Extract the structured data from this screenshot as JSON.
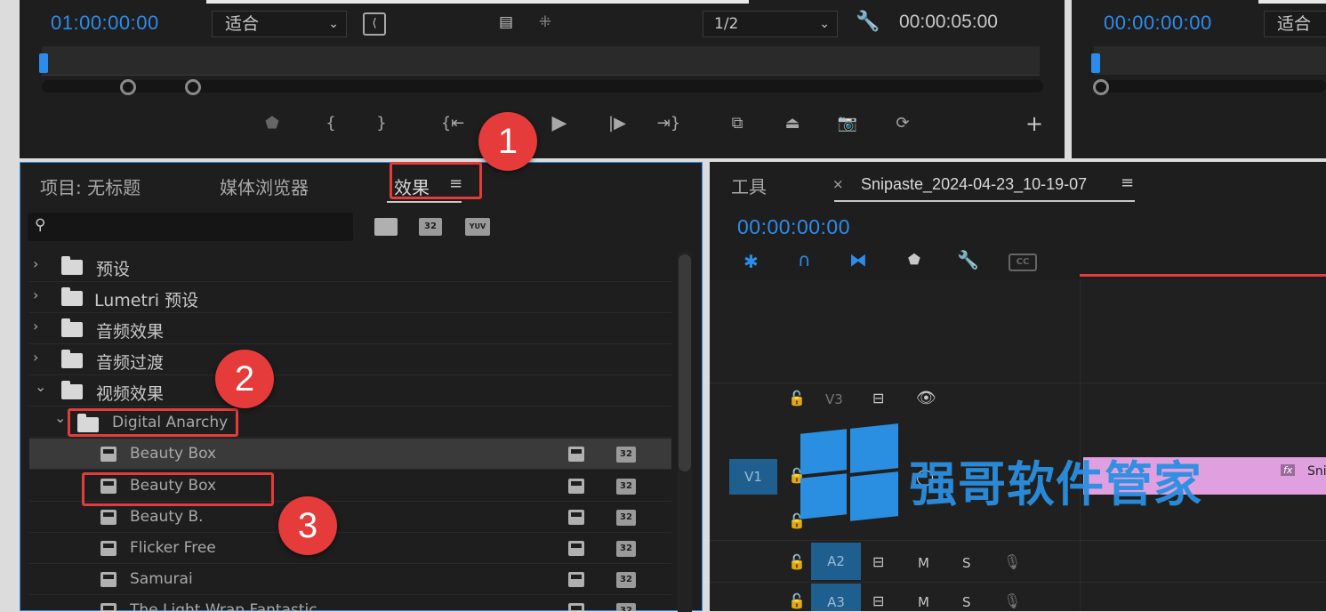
{
  "source_monitor": {
    "timecode": "01:00:00:00",
    "fit_select": "适合",
    "resolution_select": "1/2",
    "duration": "00:00:05:00"
  },
  "program_monitor": {
    "timecode": "00:00:00:00",
    "fit_select": "适合"
  },
  "project_panel": {
    "tabs": [
      "项目: 无标题",
      "媒体浏览器",
      "效果"
    ],
    "search_placeholder": "",
    "filter_badges": [
      "32",
      "YUV"
    ],
    "tree": [
      {
        "label": "预设",
        "type": "preset-folder",
        "expanded": false
      },
      {
        "label": "Lumetri 预设",
        "type": "preset-folder",
        "expanded": false
      },
      {
        "label": "音频效果",
        "type": "folder",
        "expanded": false
      },
      {
        "label": "音频过渡",
        "type": "folder",
        "expanded": false
      },
      {
        "label": "视频效果",
        "type": "folder",
        "expanded": true
      },
      {
        "label": "Digital Anarchy",
        "type": "folder",
        "expanded": true
      },
      {
        "label": "Beauty Box",
        "type": "effect"
      },
      {
        "label": "Beauty Box",
        "type": "effect"
      },
      {
        "label": "Beauty B.",
        "type": "effect"
      },
      {
        "label": "Flicker Free",
        "type": "effect"
      },
      {
        "label": "Samurai",
        "type": "effect"
      },
      {
        "label": "The Light Wrap Fantastic",
        "type": "effect"
      }
    ],
    "badge_32": "32"
  },
  "timeline_panel": {
    "tools_tab": "工具",
    "sequence_tab": "Snipaste_2024-04-23_10-19-07",
    "timecode": "00:00:00:00",
    "tracks": {
      "v3": "V3",
      "v1": "V1",
      "a2": "A2",
      "a3": "A3",
      "mute": "M",
      "solo": "S",
      "clip_fx": "fx",
      "clip_name": "Sni"
    },
    "cc_label": "CC"
  },
  "annotations": {
    "callout_1": "1",
    "callout_2": "2",
    "callout_3": "3"
  },
  "watermark": {
    "text": "强哥软件管家"
  },
  "colors": {
    "accent_blue": "#2d8ceb",
    "callout_red": "#e63b3b",
    "track_blue": "#1f5f8f",
    "clip_pink": "#e0a0e0"
  }
}
